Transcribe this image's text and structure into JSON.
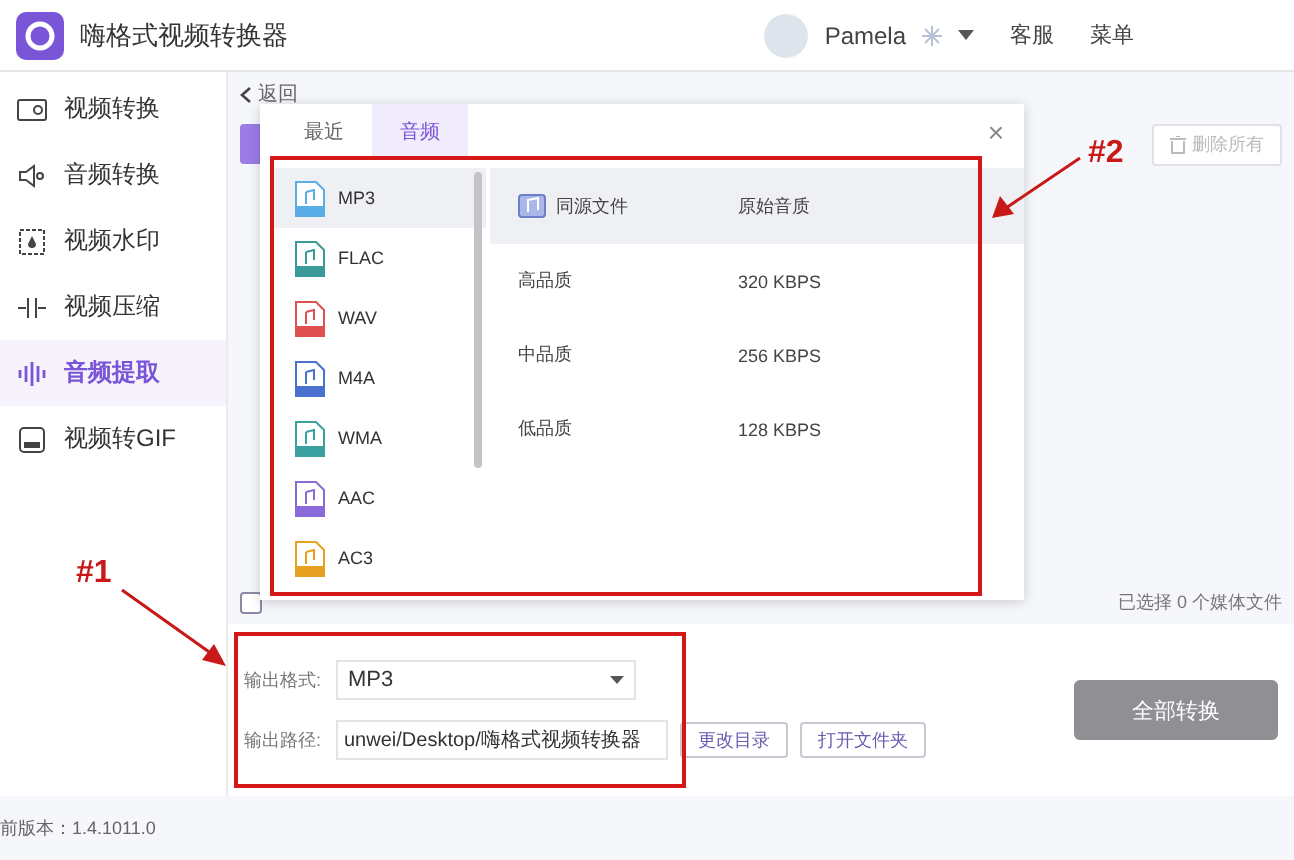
{
  "window": {
    "title": "嗨格式视频转换器"
  },
  "user": {
    "name": "Pamela"
  },
  "header_links": [
    "客服",
    "菜单"
  ],
  "sidebar": {
    "items": [
      {
        "label": "视频转换",
        "selected": false
      },
      {
        "label": "音频转换",
        "selected": false
      },
      {
        "label": "视频水印",
        "selected": false
      },
      {
        "label": "视频压缩",
        "selected": false
      },
      {
        "label": "音频提取",
        "selected": true
      },
      {
        "label": "视频转GIF",
        "selected": false
      }
    ]
  },
  "back_link": "返回",
  "delete_all": {
    "label": "删除所有",
    "disabled": true
  },
  "selection_status": "已选择 0 个媒体文件",
  "select_all": {
    "checked": false
  },
  "format_dialog": {
    "tabs": [
      {
        "label": "最近",
        "selected": false
      },
      {
        "label": "音频",
        "selected": true
      }
    ],
    "close": "×",
    "formats": [
      {
        "label": "MP3",
        "color": "#5aaee8",
        "selected": true
      },
      {
        "label": "FLAC",
        "color": "#3a9a9a",
        "selected": false
      },
      {
        "label": "WAV",
        "color": "#e05050",
        "selected": false
      },
      {
        "label": "M4A",
        "color": "#4a70d0",
        "selected": false
      },
      {
        "label": "WMA",
        "color": "#3aa0a0",
        "selected": false
      },
      {
        "label": "AAC",
        "color": "#8a6ad8",
        "selected": false
      },
      {
        "label": "AC3",
        "color": "#e8a020",
        "selected": false
      }
    ],
    "qualities": [
      {
        "name": "同源文件",
        "bitrate": "原始音质",
        "selected": true
      },
      {
        "name": "高品质",
        "bitrate": "320 KBPS",
        "selected": false
      },
      {
        "name": "中品质",
        "bitrate": "256 KBPS",
        "selected": false
      },
      {
        "name": "低品质",
        "bitrate": "128 KBPS",
        "selected": false
      }
    ]
  },
  "output": {
    "format_label": "输出格式:",
    "format": "MP3",
    "path_label": "输出路径:",
    "path": "unwei/Desktop/嗨格式视频转换器",
    "buttons": [
      "更改目录",
      "打开文件夹"
    ]
  },
  "convert_all": {
    "label": "全部转换",
    "disabled": true
  },
  "version": "前版本：1.4.1011.0",
  "annotations": [
    {
      "label": "#1"
    },
    {
      "label": "#2"
    }
  ]
}
